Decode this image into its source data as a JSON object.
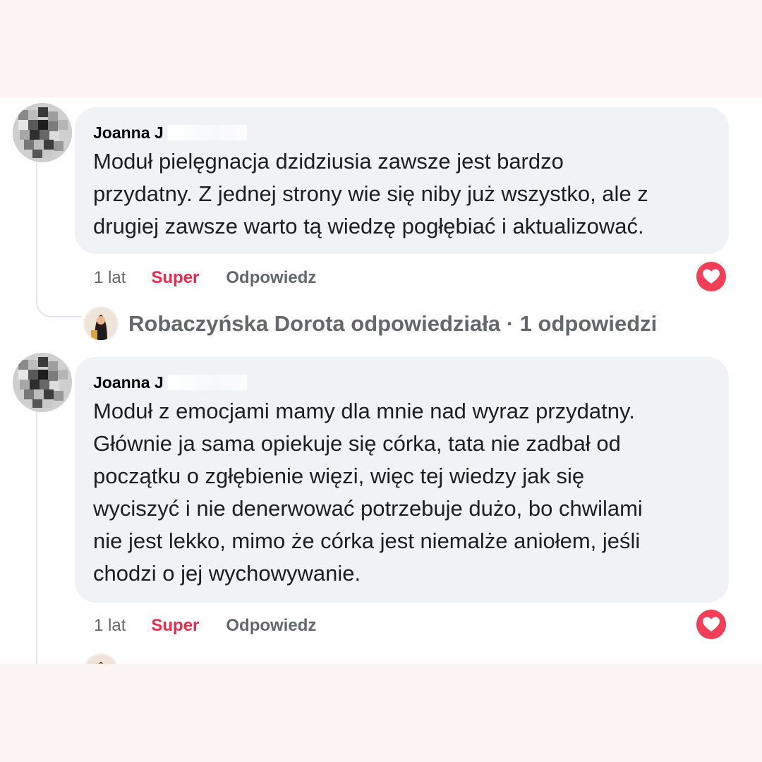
{
  "comments": [
    {
      "author": "Joanna J",
      "text": "Moduł pielęgnacja dzidziusia zawsze jest bardzo\nprzydatny. Z jednej strony wie się niby już wszystko, ale z\ndrugiej zawsze warto tą wiedzę pogłębiać i aktualizować.",
      "time": "1 lat",
      "like_label": "Super",
      "reply_label": "Odpowiedz",
      "reaction": "heart-icon",
      "replies_summary": "Robaczyńska Dorota odpowiedziała · 1 odpowiedzi"
    },
    {
      "author": "Joanna J",
      "text": "Moduł z emocjami mamy dla mnie nad wyraz przydatny.\nGłównie ja sama opiekuje się córka, tata nie zadbał od\npoczątku o zgłębienie więzi, więc tej wiedzy jak się\nwyciszyć i nie denerwować potrzebuje dużo, bo chwilami\nnie jest lekko, mimo że córka jest niemalże aniołem, jeśli\nchodzi o jej wychowywanie.",
      "time": "1 lat",
      "like_label": "Super",
      "reply_label": "Odpowiedz",
      "reaction": "heart-icon"
    }
  ],
  "colors": {
    "like_active": "#f02849",
    "bubble": "#f0f2f5",
    "heart": "#f33e58"
  }
}
